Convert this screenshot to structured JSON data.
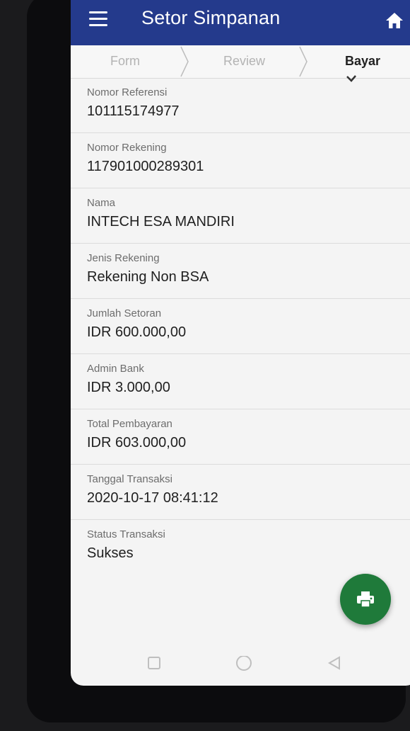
{
  "header": {
    "title": "Setor Simpanan",
    "menu_icon": "hamburger-menu-icon",
    "home_icon": "home-icon",
    "bar_color": "#243a8c"
  },
  "stepper": {
    "steps": [
      {
        "label": "Form",
        "active": false
      },
      {
        "label": "Review",
        "active": false
      },
      {
        "label": "Bayar",
        "active": true
      }
    ]
  },
  "details": [
    {
      "label": "Nomor Referensi",
      "value": "101115174977"
    },
    {
      "label": "Nomor Rekening",
      "value": "117901000289301"
    },
    {
      "label": "Nama",
      "value": "INTECH ESA MANDIRI"
    },
    {
      "label": "Jenis Rekening",
      "value": "Rekening Non BSA"
    },
    {
      "label": "Jumlah Setoran",
      "value": "IDR 600.000,00"
    },
    {
      "label": "Admin Bank",
      "value": "IDR 3.000,00"
    },
    {
      "label": "Total Pembayaran",
      "value": "IDR 603.000,00"
    },
    {
      "label": "Tanggal Transaksi",
      "value": "2020-10-17 08:41:12"
    },
    {
      "label": "Status Transaksi",
      "value": "Sukses"
    }
  ],
  "fab": {
    "icon": "printer-icon",
    "color": "#1f7a3a"
  },
  "system_nav": {
    "icons": [
      "recent-apps-icon",
      "home-circle-icon",
      "back-triangle-icon"
    ]
  }
}
